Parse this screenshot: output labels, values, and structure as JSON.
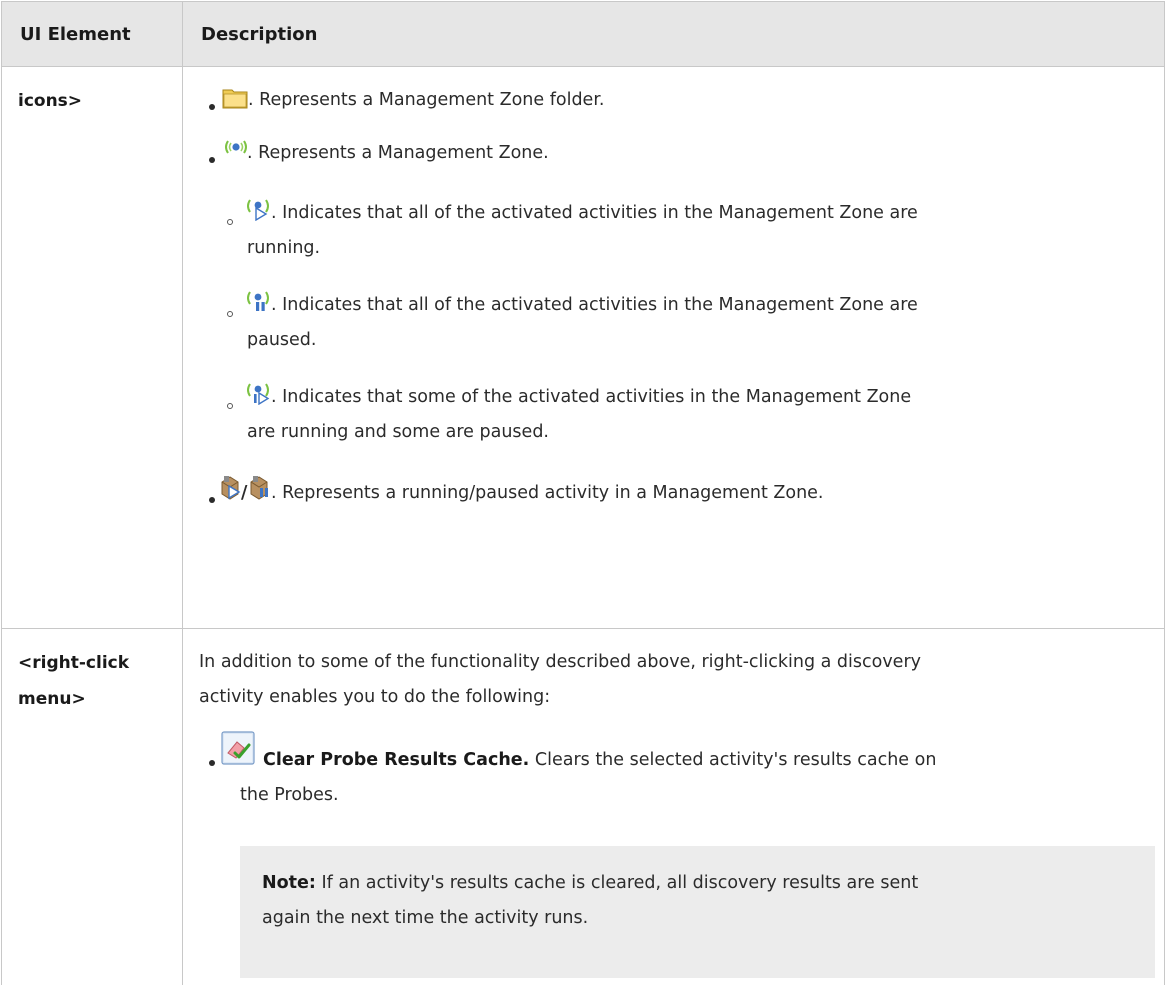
{
  "header": {
    "col1": "UI Element",
    "col2": "Description"
  },
  "row1": {
    "label": "icons>",
    "items": [
      {
        "icon": "folder-icon",
        "text": ". Represents a Management Zone folder."
      },
      {
        "icon": "management-zone-icon",
        "text": ". Represents a Management Zone."
      },
      {
        "icon": "zone-running-icon",
        "text_line1": ". Indicates that all of the activated activities in the Management Zone are",
        "text_line2": "running."
      },
      {
        "icon": "zone-paused-icon",
        "text_line1": ". Indicates that all of the activated activities in the Management Zone are",
        "text_line2": "paused."
      },
      {
        "icon": "zone-mixed-icon",
        "text_line1": ". Indicates that some of the activated activities in the Management Zone",
        "text_line2": "are running and some are paused."
      },
      {
        "icon": "activity-running-paused-icon",
        "separator": "/",
        "text": ". Represents a running/paused activity in a Management Zone."
      }
    ]
  },
  "row2": {
    "label_line1": "<right-click",
    "label_line2": "menu>",
    "intro_line1": "In addition to some of the functionality described above, right-clicking a discovery",
    "intro_line2": "activity enables you to do the following:",
    "item": {
      "icon": "clear-cache-icon",
      "title": "Clear Probe Results Cache.",
      "text_line1": " Clears the selected activity's results cache on",
      "text_line2": "the Probes."
    },
    "note": {
      "label": "Note:",
      "text_line1": " If an activity's results cache is cleared, all discovery results are sent",
      "text_line2": "again the next time the activity runs."
    }
  },
  "colors": {
    "header_bg": "#e6e6e6",
    "note_bg": "#ececec",
    "border": "#c8c8c8"
  }
}
